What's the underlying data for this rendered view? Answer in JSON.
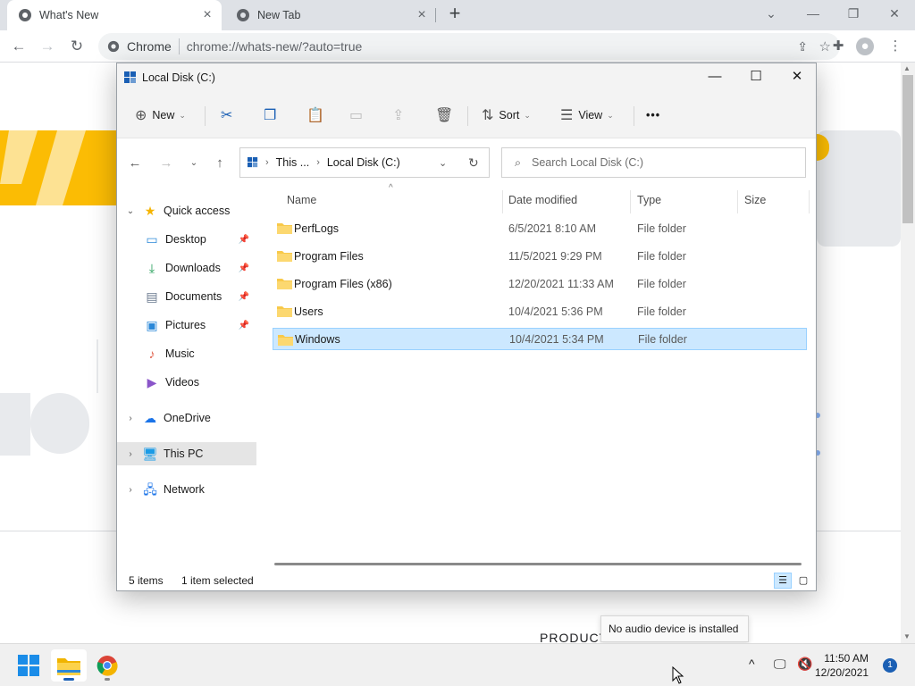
{
  "browser": {
    "tabs": [
      {
        "label": "What's New",
        "active": true
      },
      {
        "label": "New Tab",
        "active": false
      }
    ],
    "omnibox": {
      "site_label": "Chrome",
      "url": "chrome://whats-new/?auto=true"
    }
  },
  "page": {
    "partial_text": "PRODUCT"
  },
  "explorer": {
    "title": "Local Disk (C:)",
    "ribbon": {
      "new_label": "New",
      "sort_label": "Sort",
      "view_label": "View",
      "more_label": "•••"
    },
    "address": {
      "segment_1": "This ...",
      "segment_2": "Local Disk (C:)"
    },
    "search_placeholder": "Search Local Disk (C:)",
    "nav": {
      "quick_access": "Quick access",
      "desktop": "Desktop",
      "downloads": "Downloads",
      "documents": "Documents",
      "pictures": "Pictures",
      "music": "Music",
      "videos": "Videos",
      "onedrive": "OneDrive",
      "this_pc": "This PC",
      "network": "Network"
    },
    "columns": {
      "name": "Name",
      "date": "Date modified",
      "type": "Type",
      "size": "Size"
    },
    "files": [
      {
        "name": "PerfLogs",
        "date": "6/5/2021 8:10 AM",
        "type": "File folder"
      },
      {
        "name": "Program Files",
        "date": "11/5/2021 9:29 PM",
        "type": "File folder"
      },
      {
        "name": "Program Files (x86)",
        "date": "12/20/2021 11:33 AM",
        "type": "File folder"
      },
      {
        "name": "Users",
        "date": "10/4/2021 5:36 PM",
        "type": "File folder"
      },
      {
        "name": "Windows",
        "date": "10/4/2021 5:34 PM",
        "type": "File folder",
        "selected": true
      }
    ],
    "status": {
      "count": "5 items",
      "selected": "1 item selected"
    }
  },
  "toast": {
    "message": "No audio device is installed"
  },
  "taskbar": {
    "clock_time": "11:50 AM",
    "clock_date": "12/20/2021",
    "notification_count": "1"
  },
  "colors": {
    "accent": "#1a5fb4",
    "folder": "#f8c94a",
    "selection": "#cce8ff",
    "banner_yellow": "#fbbc04"
  }
}
